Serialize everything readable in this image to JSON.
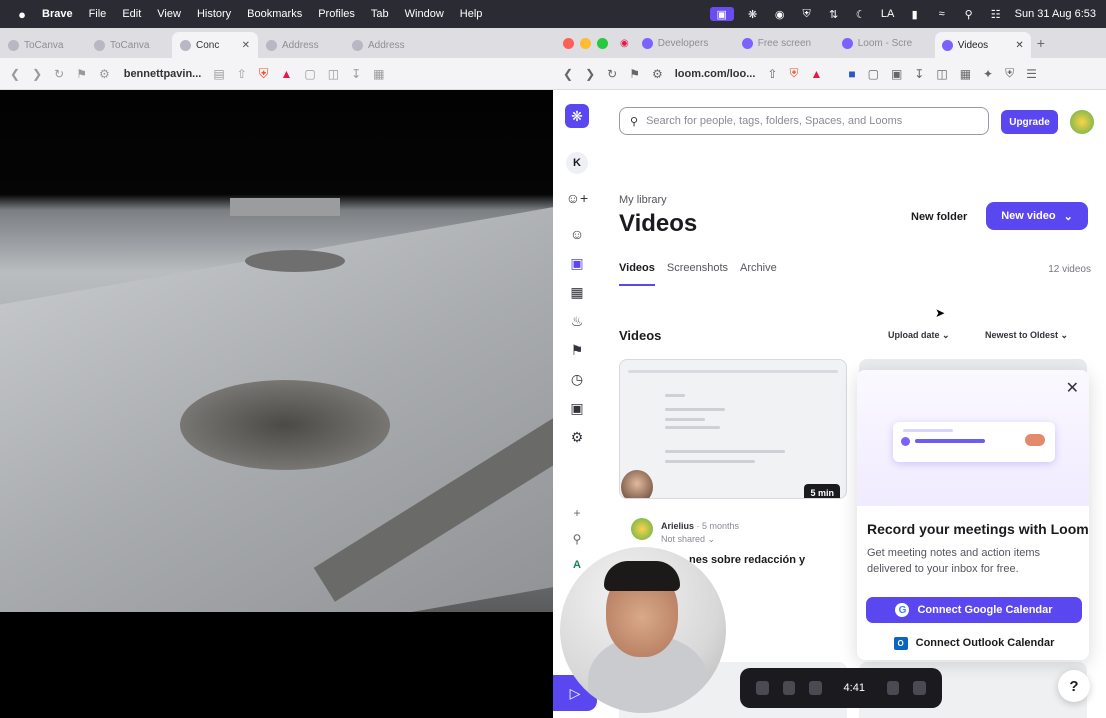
{
  "menubar": {
    "apple": "",
    "items": [
      "Brave",
      "File",
      "Edit",
      "View",
      "History",
      "Bookmarks",
      "Profiles",
      "Tab",
      "Window",
      "Help"
    ],
    "clock": "Sun 31 Aug 6:53",
    "layout": "LA"
  },
  "left_browser": {
    "tabs": [
      "ToCanva",
      "ToCanva",
      "Conc",
      "Address",
      "Address"
    ],
    "active_tab_index": 2,
    "url": "bennettpavin..."
  },
  "right_browser": {
    "tabs": [
      "Developers",
      "Free screen",
      "Loom - Scre",
      "Videos"
    ],
    "active_tab": "Videos",
    "url": "loom.com/loo..."
  },
  "loom": {
    "search_placeholder": "Search for people, tags, folders, Spaces, and Looms",
    "upgrade": "Upgrade",
    "workspace_initial": "K",
    "breadcrumb": "My library",
    "title": "Videos",
    "new_folder": "New folder",
    "new_video": "New video",
    "tabs": [
      "Videos",
      "Screenshots",
      "Archive"
    ],
    "count": "12 videos",
    "section": "Videos",
    "sort_by": "Upload date",
    "sort_order": "Newest to Oldest",
    "sidebar_bottom_initial": "A",
    "card": {
      "duration": "5 min",
      "author": "Arielius",
      "age": "· 5 months",
      "shared": "Not shared",
      "title_visible": "nes sobre redacción y"
    },
    "popover": {
      "title": "Record your meetings with Loom",
      "description": "Get meeting notes and action items delivered to your inbox for free.",
      "google_button": "Connect Google Calendar",
      "outlook_button": "Connect Outlook Calendar"
    },
    "recording_timer": "4:41",
    "help": "?"
  }
}
